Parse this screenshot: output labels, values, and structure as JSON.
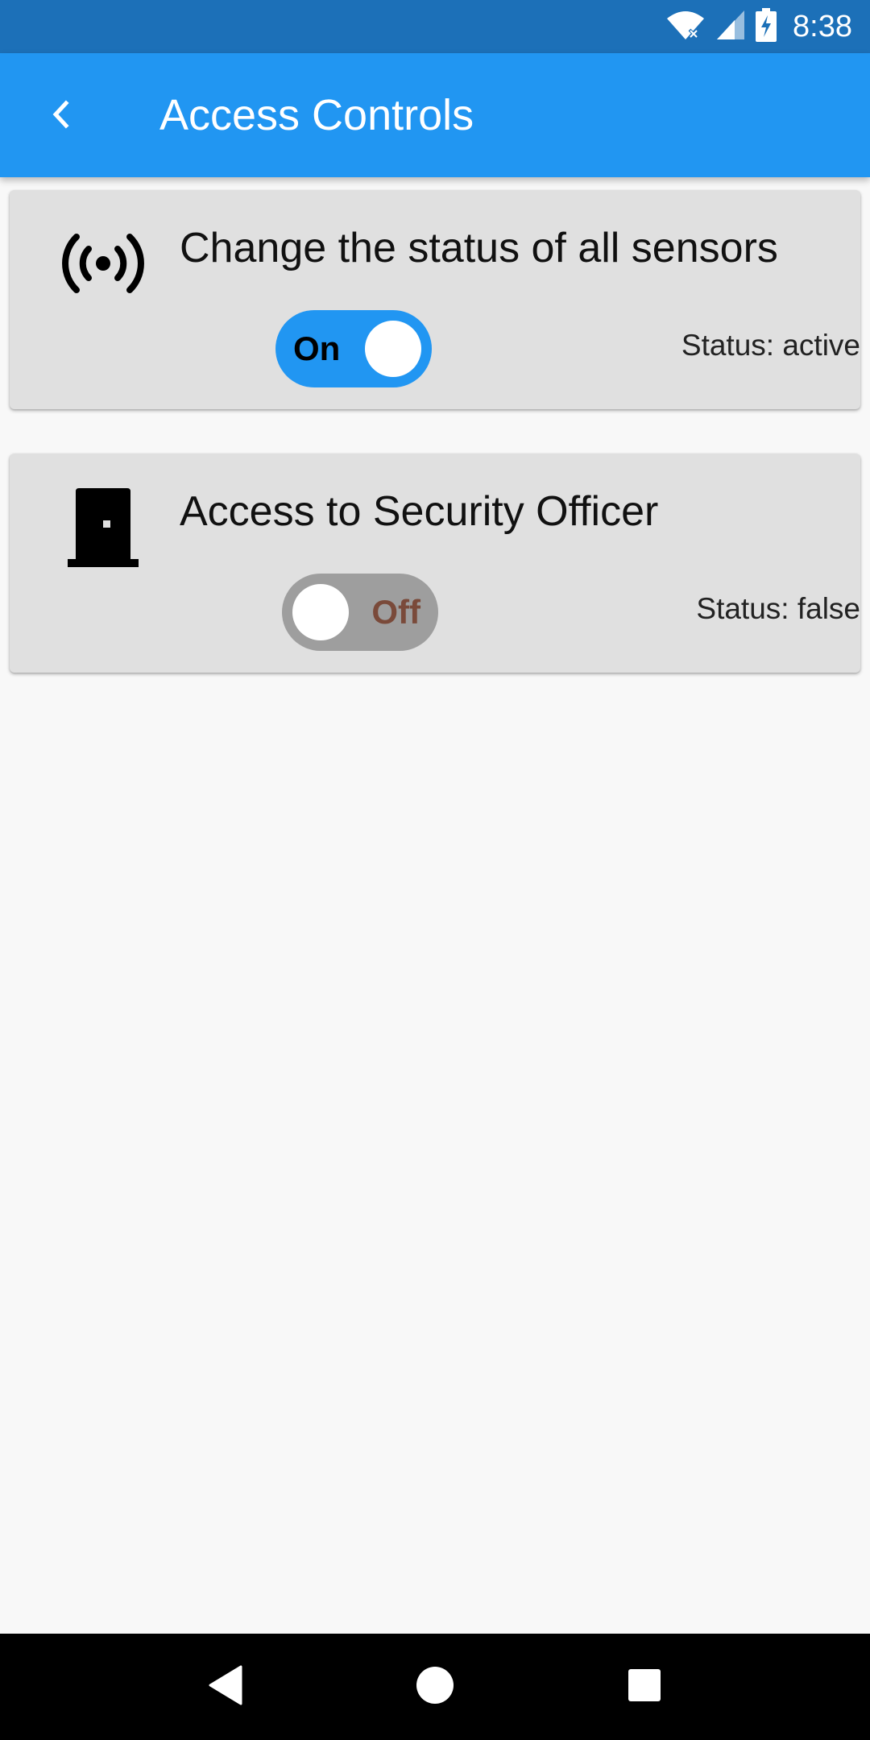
{
  "status_bar": {
    "time": "8:38",
    "icons": [
      "wifi-icon",
      "signal-icon",
      "battery-charging-icon"
    ]
  },
  "app_bar": {
    "title": "Access Controls",
    "back_icon": "chevron-left-icon",
    "color": "#2196f2"
  },
  "cards": [
    {
      "icon": "sensors-icon",
      "title": "Change the status of all sensors",
      "toggle": {
        "state": true,
        "label": "On",
        "color": "#2196f2"
      },
      "status": "Status: active"
    },
    {
      "icon": "door-icon",
      "title": "Access to Security Officer",
      "toggle": {
        "state": false,
        "label": "Off",
        "color": "#9e9e9e"
      },
      "status": "Status: false"
    }
  ],
  "nav_bar": {
    "buttons": [
      "back-triangle-icon",
      "home-circle-icon",
      "recents-square-icon"
    ]
  }
}
